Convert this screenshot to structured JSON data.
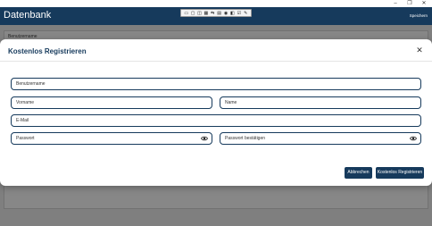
{
  "app": {
    "title": "Datenbank",
    "save_label": "Speichern",
    "background_label": "Benutzername",
    "toolbar_icons": [
      "layout-icon",
      "screen-icon",
      "window-icon",
      "grid-icon",
      "share-icon",
      "tag-icon",
      "record-icon",
      "pin-icon",
      "check-icon",
      "pen-icon"
    ],
    "window_controls": [
      "–",
      "❐",
      "✕"
    ]
  },
  "dialog": {
    "title": "Kostenlos Registrieren",
    "close_label": "✕",
    "fields": {
      "username": {
        "placeholder": "Benutzername"
      },
      "firstname": {
        "placeholder": "Vorname"
      },
      "lastname": {
        "placeholder": "Name"
      },
      "email": {
        "placeholder": "E-Mail"
      },
      "password": {
        "placeholder": "Passwort"
      },
      "password_confirm": {
        "placeholder": "Passwort bestätigen"
      }
    },
    "buttons": {
      "cancel": "Abbrechen",
      "register": "Kostenlos Registrieren"
    }
  },
  "colors": {
    "accent": "#163a5c",
    "overlay": "#000000"
  }
}
